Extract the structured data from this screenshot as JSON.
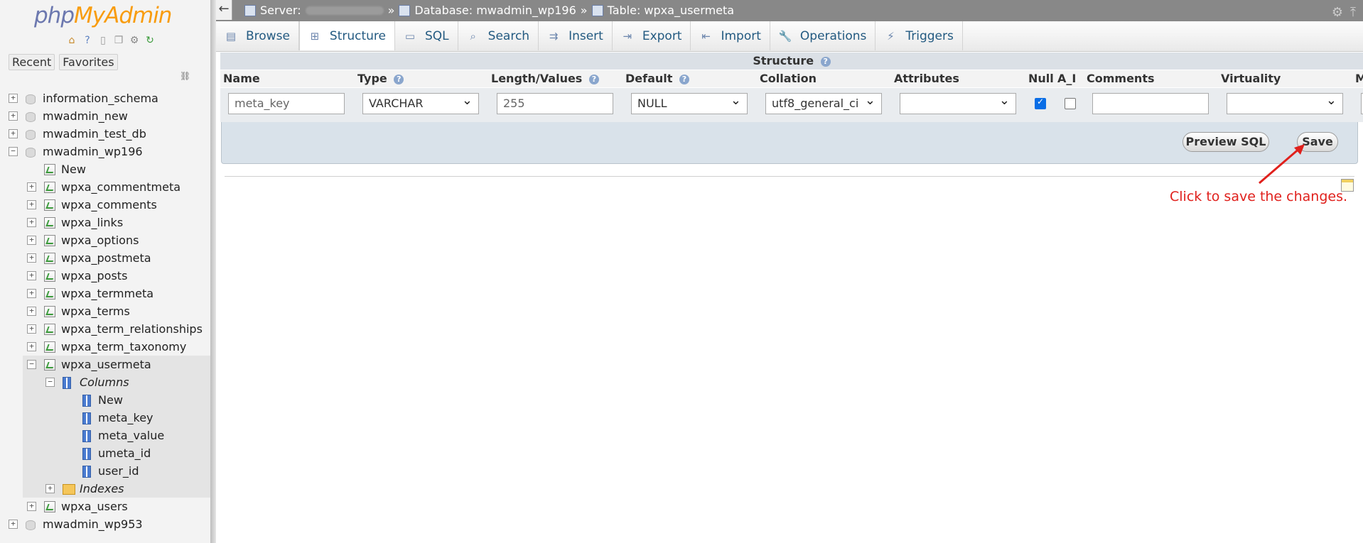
{
  "logo": {
    "part1": "php",
    "part2": "MyAdmin"
  },
  "sidebar": {
    "nav_icons": [
      "home-icon",
      "help-icon",
      "docs-icon",
      "copy-icon",
      "settings-icon",
      "reload-icon"
    ],
    "recent_label": "Recent",
    "favorites_label": "Favorites",
    "tree": {
      "db_information_schema": "information_schema",
      "db_mwadmin_new": "mwadmin_new",
      "db_mwadmin_test_db": "mwadmin_test_db",
      "db_mwadmin_wp196": "mwadmin_wp196",
      "new_label": "New",
      "tables": [
        "wpxa_commentmeta",
        "wpxa_comments",
        "wpxa_links",
        "wpxa_options",
        "wpxa_postmeta",
        "wpxa_posts",
        "wpxa_termmeta",
        "wpxa_terms",
        "wpxa_term_relationships",
        "wpxa_term_taxonomy"
      ],
      "selected_table": "wpxa_usermeta",
      "columns_label": "Columns",
      "columns_new_label": "New",
      "columns": [
        "meta_key",
        "meta_value",
        "umeta_id",
        "user_id"
      ],
      "indexes_label": "Indexes",
      "table_wpxa_users": "wpxa_users",
      "db_mwadmin_wp953": "mwadmin_wp953"
    }
  },
  "topbar": {
    "back_label": "←",
    "server_label": "Server:",
    "sep": "»",
    "database": "Database: mwadmin_wp196",
    "table": "Table: wpxa_usermeta"
  },
  "tabs": [
    {
      "label": "Browse",
      "icon": "browse-icon"
    },
    {
      "label": "Structure",
      "icon": "structure-icon"
    },
    {
      "label": "SQL",
      "icon": "sql-icon"
    },
    {
      "label": "Search",
      "icon": "search-icon"
    },
    {
      "label": "Insert",
      "icon": "insert-icon"
    },
    {
      "label": "Export",
      "icon": "export-icon"
    },
    {
      "label": "Import",
      "icon": "import-icon"
    },
    {
      "label": "Operations",
      "icon": "operations-icon"
    },
    {
      "label": "Triggers",
      "icon": "triggers-icon"
    }
  ],
  "structure": {
    "title": "Structure",
    "headers": {
      "name": "Name",
      "type": "Type",
      "length": "Length/Values",
      "default": "Default",
      "collation": "Collation",
      "attributes": "Attributes",
      "null": "Null",
      "ai": "A_I",
      "comments": "Comments",
      "virtuality": "Virtuality",
      "more": "M"
    },
    "row": {
      "name": "meta_key",
      "type": "VARCHAR",
      "length": "255",
      "default": "NULL",
      "collation": "utf8_general_ci",
      "attributes": "",
      "null_checked": true,
      "ai_checked": false,
      "comments": "",
      "virtuality": ""
    },
    "preview_sql_label": "Preview SQL",
    "save_label": "Save"
  },
  "annotation": {
    "text": "Click to save the changes.",
    "color": "#e0201c"
  }
}
